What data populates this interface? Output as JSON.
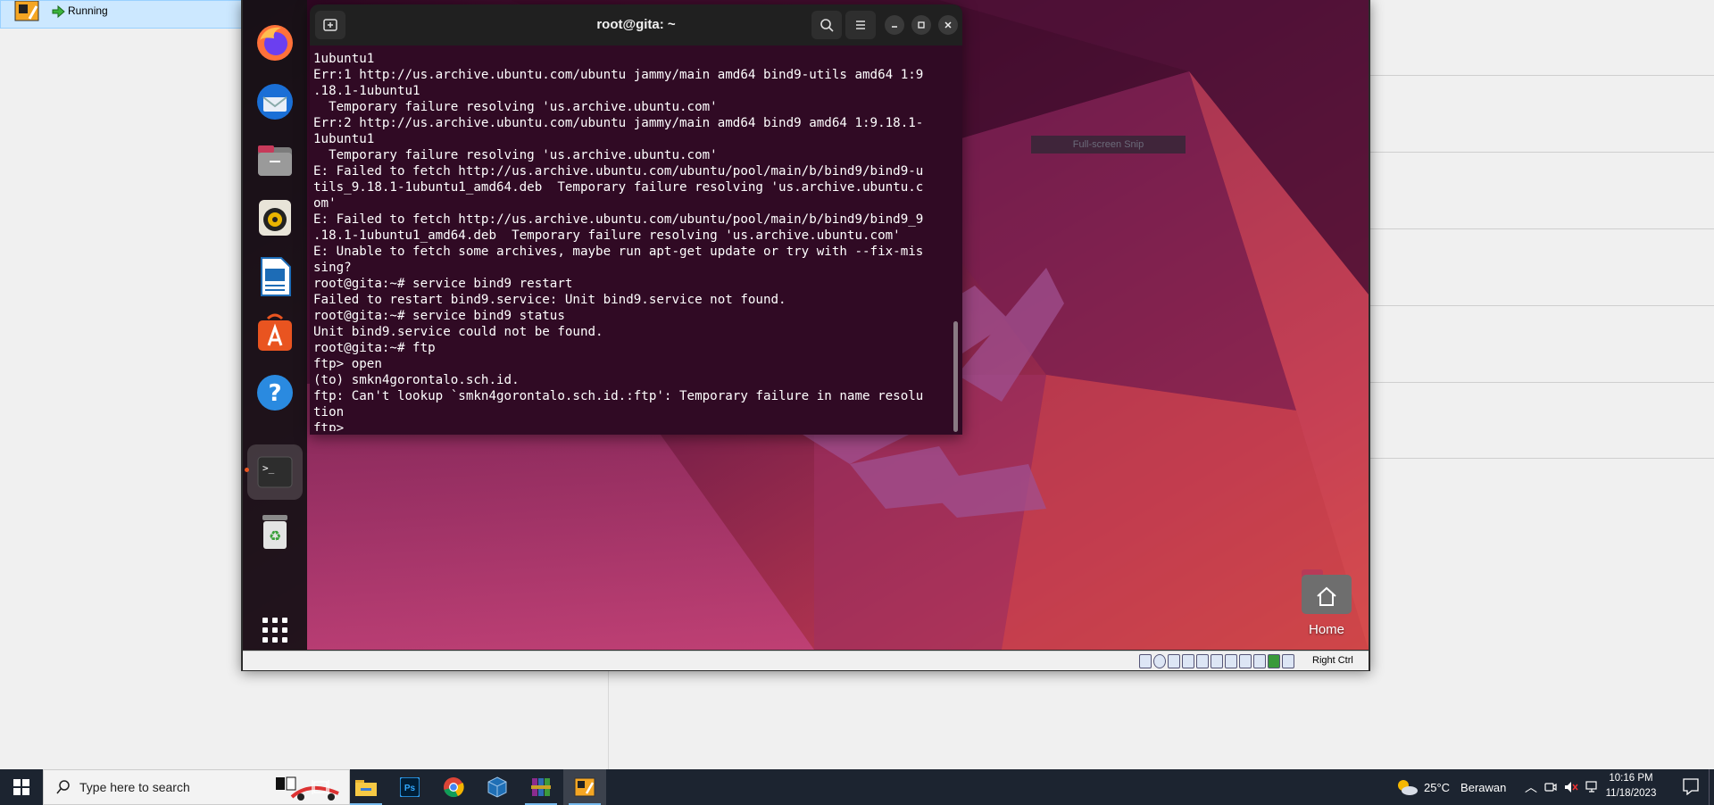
{
  "vbox_manager": {
    "vm_state": "Running"
  },
  "terminal": {
    "title": "root@gita: ~",
    "lines": [
      "1ubuntu1",
      "Err:1 http://us.archive.ubuntu.com/ubuntu jammy/main amd64 bind9-utils amd64 1:9",
      ".18.1-1ubuntu1",
      "  Temporary failure resolving 'us.archive.ubuntu.com'",
      "Err:2 http://us.archive.ubuntu.com/ubuntu jammy/main amd64 bind9 amd64 1:9.18.1-",
      "1ubuntu1",
      "  Temporary failure resolving 'us.archive.ubuntu.com'",
      "E: Failed to fetch http://us.archive.ubuntu.com/ubuntu/pool/main/b/bind9/bind9-u",
      "tils_9.18.1-1ubuntu1_amd64.deb  Temporary failure resolving 'us.archive.ubuntu.c",
      "om'",
      "E: Failed to fetch http://us.archive.ubuntu.com/ubuntu/pool/main/b/bind9/bind9_9",
      ".18.1-1ubuntu1_amd64.deb  Temporary failure resolving 'us.archive.ubuntu.com'",
      "E: Unable to fetch some archives, maybe run apt-get update or try with --fix-mis",
      "sing?",
      "root@gita:~# service bind9 restart",
      "Failed to restart bind9.service: Unit bind9.service not found.",
      "root@gita:~# service bind9 status",
      "Unit bind9.service could not be found.",
      "root@gita:~# ftp",
      "ftp> open",
      "(to) smkn4gorontalo.sch.id.",
      "ftp: Can't lookup `smkn4gorontalo.sch.id.:ftp': Temporary failure in name resolu",
      "tion",
      "ftp> "
    ]
  },
  "overlay": {
    "snip_tooltip": "Full-screen Snip"
  },
  "desktop": {
    "home_label": "Home"
  },
  "vm_statusbar": {
    "host_key": "Right Ctrl"
  },
  "taskbar": {
    "search_placeholder": "Type here to search",
    "weather_temp": "25°C",
    "weather_desc": "Berawan",
    "time": "10:16 PM",
    "date": "11/18/2023"
  },
  "colors": {
    "terminal_bg": "#300a24",
    "ubuntu_orange": "#e95420",
    "taskbar_bg": "#1c2430"
  }
}
